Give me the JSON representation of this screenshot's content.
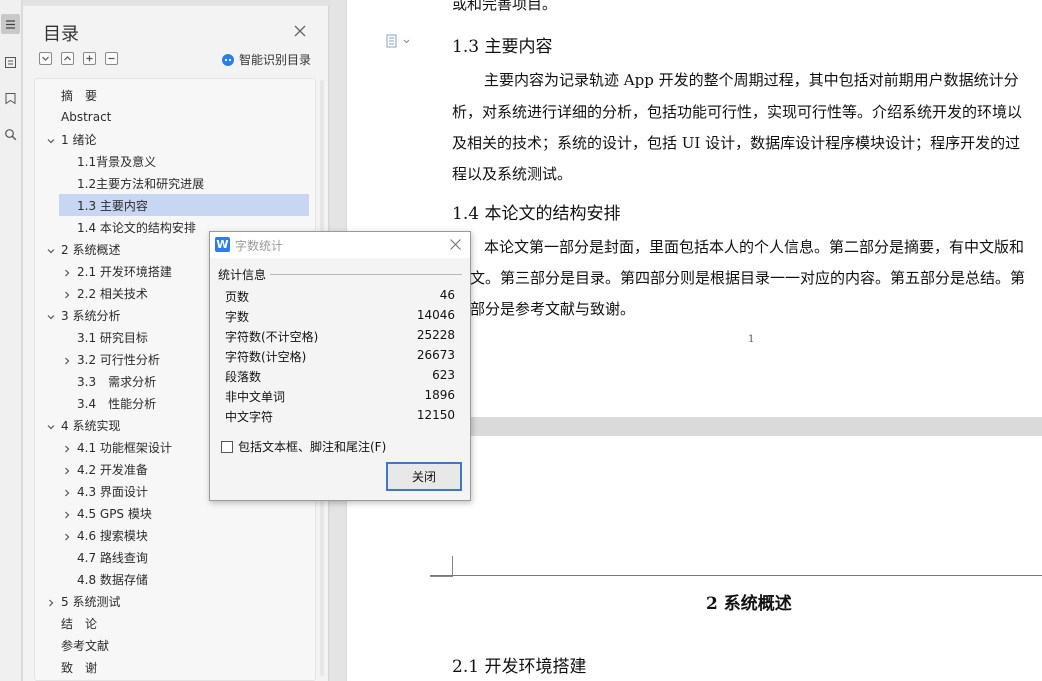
{
  "toc_panel": {
    "title": "目录",
    "smart_toc_label": "智能识别目录",
    "items": [
      {
        "label": "摘　要"
      },
      {
        "label": "Abstract"
      },
      {
        "label": "1 绪论"
      },
      {
        "label": "1.1背景及意义"
      },
      {
        "label": "1.2主要方法和研究进展"
      },
      {
        "label": "1.3 主要内容"
      },
      {
        "label": "1.4 本论文的结构安排"
      },
      {
        "label": "2 系统概述"
      },
      {
        "label": "2.1 开发环境搭建"
      },
      {
        "label": "2.2 相关技术"
      },
      {
        "label": "3 系统分析"
      },
      {
        "label": "3.1 研究目标"
      },
      {
        "label": "3.2 可行性分析"
      },
      {
        "label": "3.3　需求分析"
      },
      {
        "label": "3.4　性能分析"
      },
      {
        "label": "4 系统实现"
      },
      {
        "label": "4.1 功能框架设计"
      },
      {
        "label": "4.2 开发准备"
      },
      {
        "label": "4.3 界面设计"
      },
      {
        "label": "4.5 GPS 模块"
      },
      {
        "label": "4.6 搜索模块"
      },
      {
        "label": "4.7 路线查询"
      },
      {
        "label": "4.8 数据存储"
      },
      {
        "label": "5 系统测试"
      },
      {
        "label": "结　论"
      },
      {
        "label": "参考文献"
      },
      {
        "label": "致　谢"
      }
    ]
  },
  "document": {
    "top_cut_text": "或和完善项目。",
    "section_1_3_heading": "1.3 主要内容",
    "section_1_3_lines": [
      "主要内容为记录轨迹 App 开发的整个周期过程，其中包括对前期用户数据统计分",
      "析，对系统进行详细的分析，包括功能可行性，实现可行性等。介绍系统开发的环境以",
      "及相关的技术；系统的设计，包括 UI 设计，数据库设计程序模块设计；程序开发的过",
      "程以及系统测试。"
    ],
    "section_1_4_heading": "1.4 本论文的结构安排",
    "section_1_4_lines": [
      "本论文第一部分是封面，里面包括本人的个人信息。第二部分是摘要，有中文版和",
      "文。第三部分是目录。第四部分则是根据目录一一对应的内容。第五部分是总结。第",
      "部分是参考文献与致谢。"
    ],
    "page_number": "1",
    "chapter_2_heading": "2 系统概述",
    "section_2_1_heading": "2.1 开发环境搭建"
  },
  "word_count_dialog": {
    "title": "字数统计",
    "logo_letter": "W",
    "group_label": "统计信息",
    "stats": [
      {
        "label": "页数",
        "value": "46"
      },
      {
        "label": "字数",
        "value": "14046"
      },
      {
        "label": "字符数(不计空格)",
        "value": "25228"
      },
      {
        "label": "字符数(计空格)",
        "value": "26673"
      },
      {
        "label": "段落数",
        "value": "623"
      },
      {
        "label": "非中文单词",
        "value": "1896"
      },
      {
        "label": "中文字符",
        "value": "12150"
      }
    ],
    "checkbox_label": "包括文本框、脚注和尾注(F)",
    "checkbox_checked": false,
    "close_button_label": "关闭"
  },
  "colors": {
    "selection": "#c7d6f2",
    "accent_blue": "#3a78c9",
    "wps_logo": "#2b7de9"
  }
}
